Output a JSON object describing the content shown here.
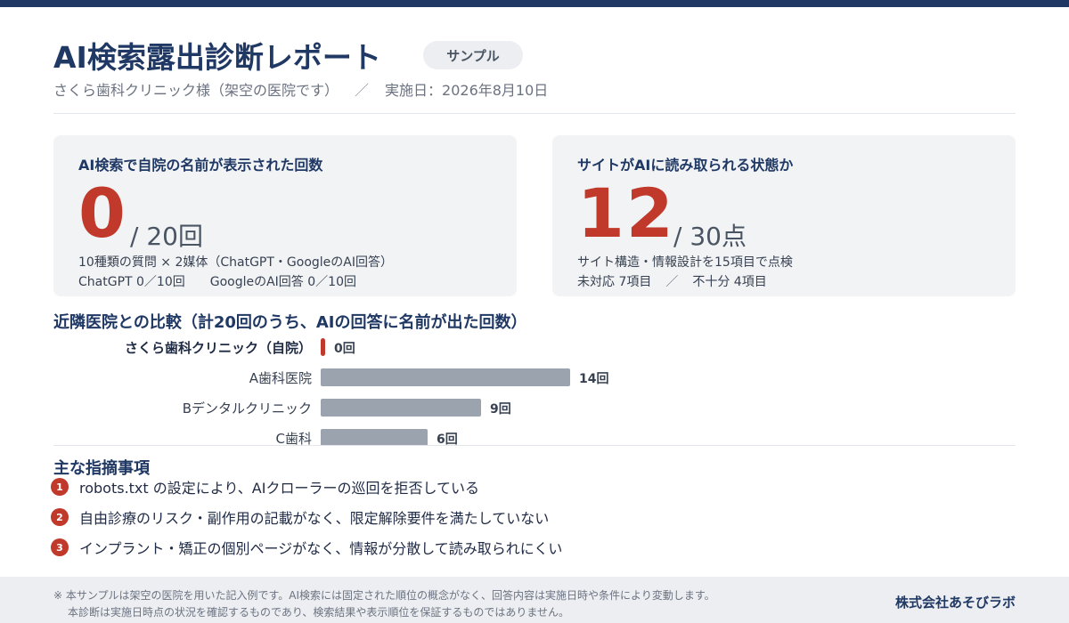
{
  "header": {
    "title": "AI検索露出診断レポート",
    "badge": "サンプル",
    "clinic": "さくら歯科クリニック様（架空の医院です）",
    "separator": "／",
    "date": "実施日：2026年8月10日"
  },
  "card_mentions": {
    "label": "AI検索で自院の名前が表示された回数",
    "value": "0",
    "denominator": "/ 20回",
    "note1": "10種類の質問 × 2媒体（ChatGPT・GoogleのAI回答）",
    "note2_a": "ChatGPT 0／10回",
    "note2_b": "GoogleのAI回答 0／10回"
  },
  "card_site": {
    "label": "サイトがAIに読み取られる状態か",
    "value": "12",
    "denominator": "/ 30点",
    "note1": "サイト構造・情報設計を15項目で点検",
    "note2_a": "未対応 7項目",
    "separator": "／",
    "note2_b": "不十分 4項目"
  },
  "comparison": {
    "title": "近隣医院との比較（計20回のうち、AIの回答に名前が出た回数）",
    "max": 20,
    "rows": [
      {
        "label": "さくら歯科クリニック（自院）",
        "value": 0,
        "value_label": "0回",
        "own": true
      },
      {
        "label": "A歯科医院",
        "value": 14,
        "value_label": "14回",
        "own": false
      },
      {
        "label": "Bデンタルクリニック",
        "value": 9,
        "value_label": "9回",
        "own": false
      },
      {
        "label": "C歯科",
        "value": 6,
        "value_label": "6回",
        "own": false
      }
    ]
  },
  "issues": {
    "title": "主な指摘事項",
    "items": [
      {
        "num": "1",
        "text": "robots.txt の設定により、AIクローラーの巡回を拒否している"
      },
      {
        "num": "2",
        "text": "自由診療のリスク・副作用の記載がなく、限定解除要件を満たしていない"
      },
      {
        "num": "3",
        "text": "インプラント・矯正の個別ページがなく、情報が分散して読み取られにくい"
      }
    ]
  },
  "footer": {
    "note1": "※ 本サンプルは架空の医院を用いた記入例です。AI検索には固定された順位の概念がなく、回答内容は実施日時や条件により変動します。",
    "note2": "本診断は実施日時点の状況を確認するものであり、検索結果や表示順位を保証するものではありません。",
    "company": "株式会社あそびラボ"
  },
  "colors": {
    "primary": "#1f3864",
    "accent": "#c0392b",
    "bar": "#9aa3ae"
  }
}
